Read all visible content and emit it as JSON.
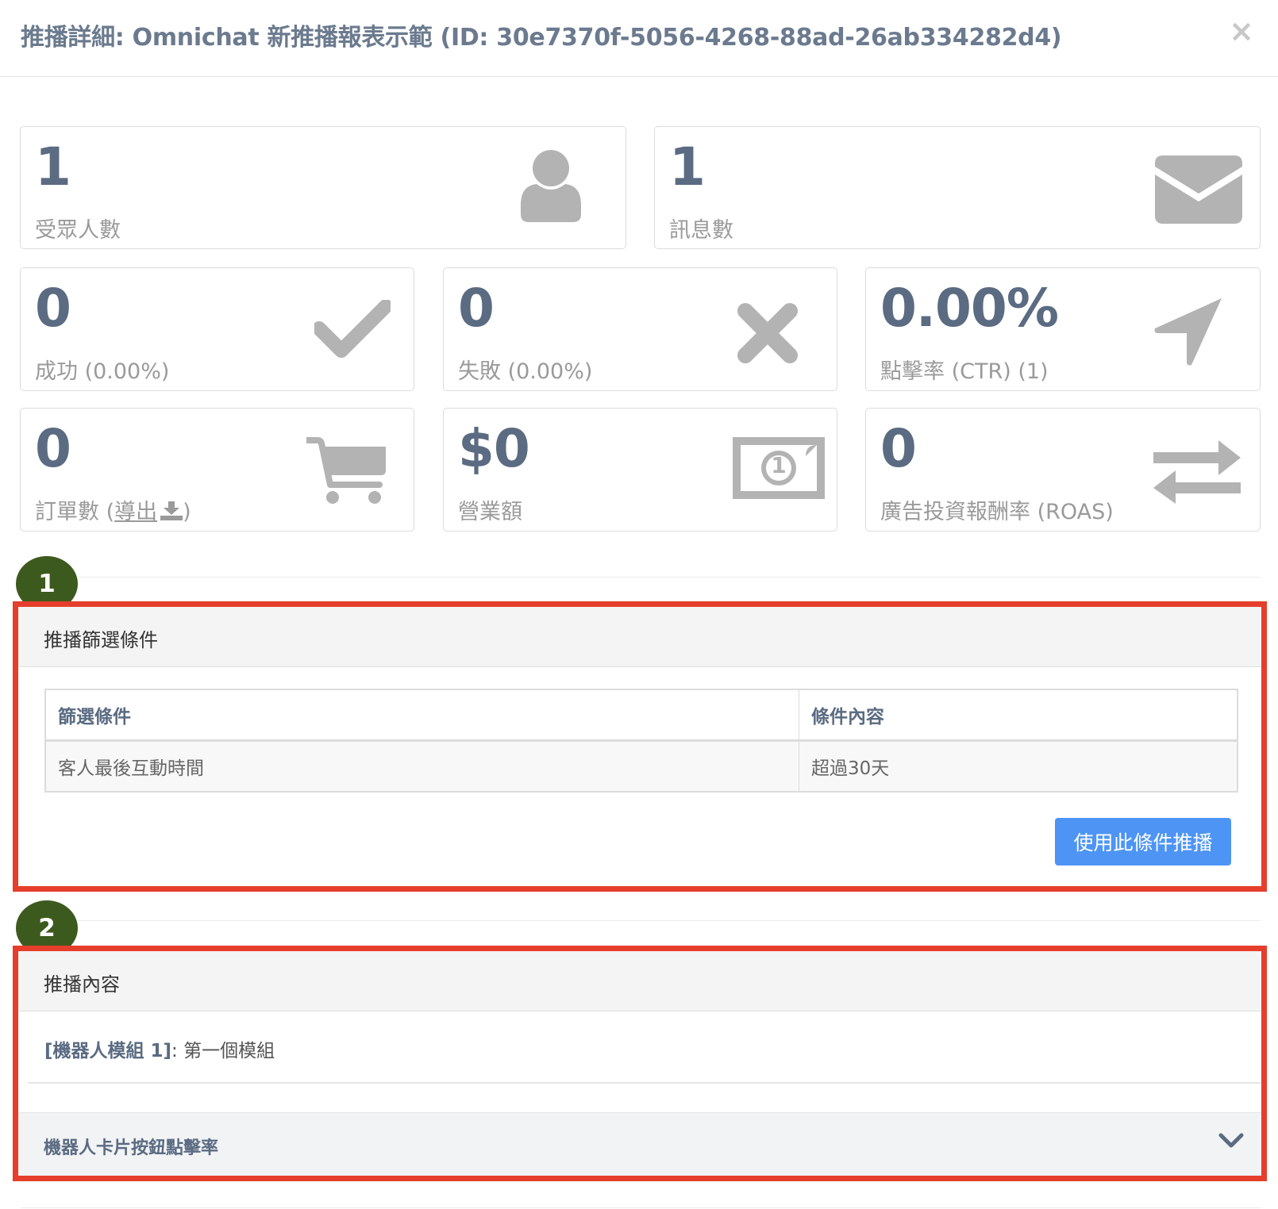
{
  "modal": {
    "title": "推播詳細: Omnichat 新推播報表示範 (ID: 30e7370f-5056-4268-88ad-26ab334282d4)",
    "close": "×"
  },
  "stats": {
    "audience": {
      "value": "1",
      "label": "受眾人數",
      "icon": "user-icon"
    },
    "messages": {
      "value": "1",
      "label": "訊息數",
      "icon": "envelope-icon"
    },
    "success": {
      "value": "0",
      "label": "成功 (0.00%)",
      "icon": "check-icon"
    },
    "failure": {
      "value": "0",
      "label": "失敗 (0.00%)",
      "icon": "x-icon"
    },
    "ctr": {
      "value": "0.00%",
      "label": "點擊率 (CTR) (1)",
      "icon": "location-arrow-icon"
    },
    "orders": {
      "value": "0",
      "label_prefix": "訂單數 (",
      "export": "導出",
      "label_suffix": ")",
      "icon": "cart-icon"
    },
    "revenue": {
      "value": "$0",
      "label": "營業額",
      "icon": "money-bill-icon",
      "bill_digit": "1"
    },
    "roas": {
      "value": "0",
      "label": "廣告投資報酬率 (ROAS)",
      "icon": "exchange-icon"
    }
  },
  "section1": {
    "badge": "1",
    "heading": "推播篩選條件",
    "table": {
      "headers": [
        "篩選條件",
        "條件內容"
      ],
      "rows": [
        [
          "客人最後互動時間",
          "超過30天"
        ]
      ]
    },
    "button": "使用此條件推播"
  },
  "section2": {
    "badge": "2",
    "heading": "推播內容",
    "module_label": "[機器人模組 1]",
    "module_name": ": 第一個模組",
    "accordion_label": "機器人卡片按鈕點擊率"
  },
  "colors": {
    "annotation_border": "#e53e2b",
    "badge": "#3d5a1e",
    "primary_button": "#4d94f5",
    "stat_number": "#5a6b82",
    "icon_gray": "#b3b3b3"
  }
}
